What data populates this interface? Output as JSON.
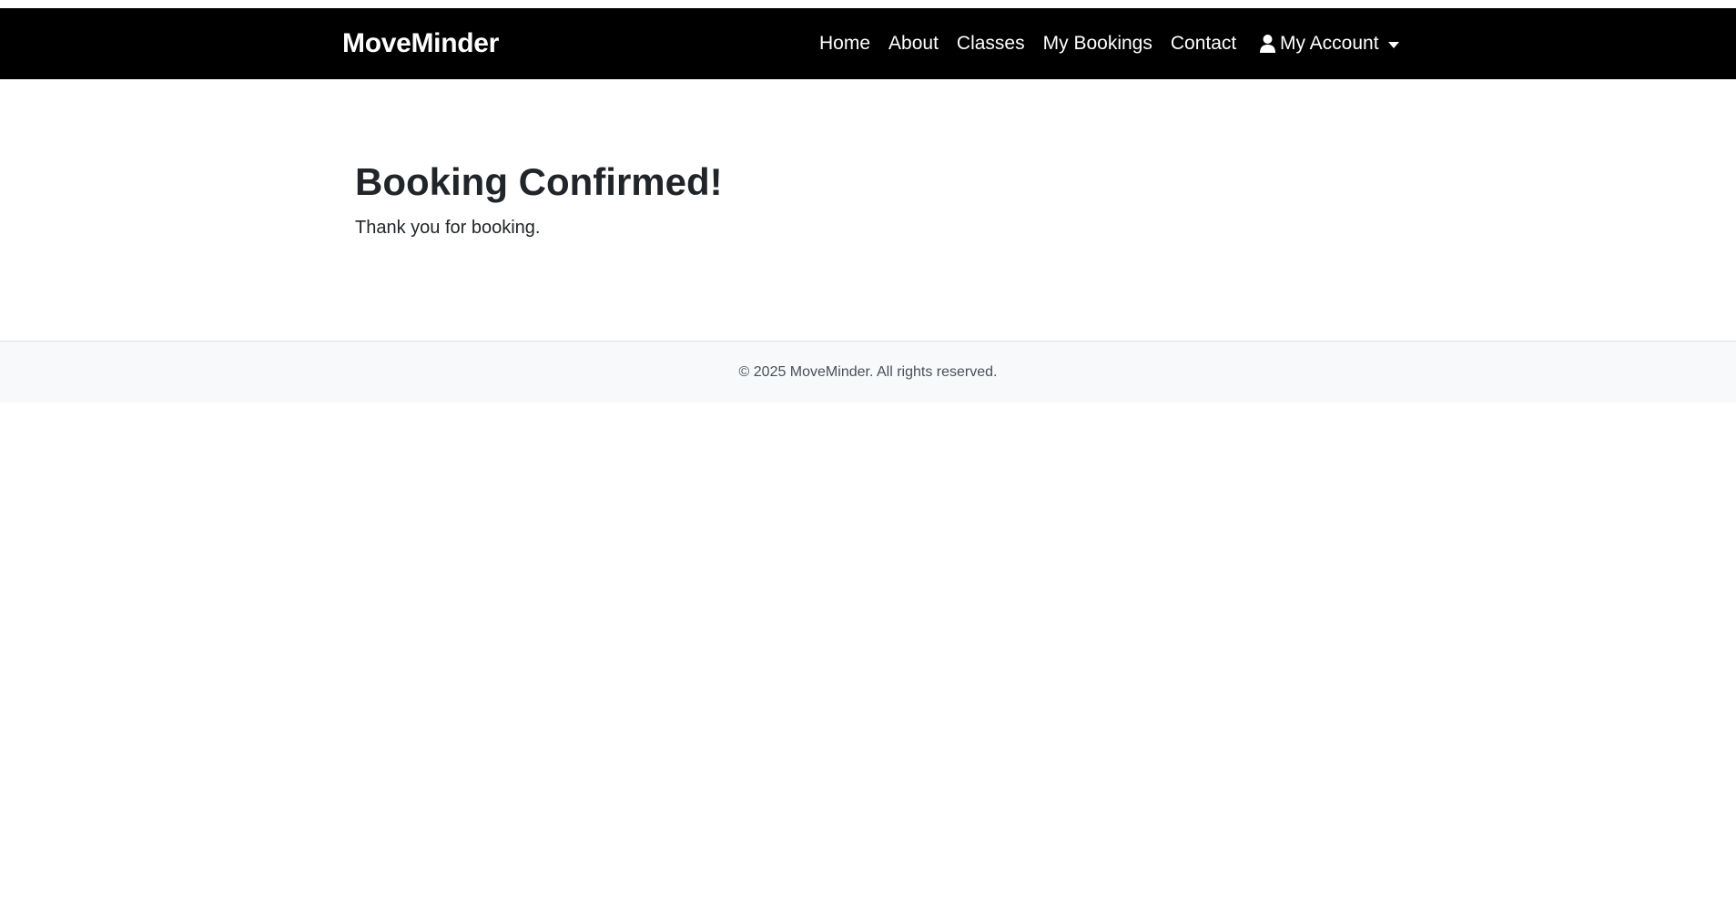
{
  "navbar": {
    "brand": "MoveMinder",
    "links": [
      {
        "label": "Home"
      },
      {
        "label": "About"
      },
      {
        "label": "Classes"
      },
      {
        "label": "My Bookings"
      },
      {
        "label": "Contact"
      }
    ],
    "account": {
      "label": "My Account",
      "icon": "user-icon"
    }
  },
  "main": {
    "title": "Booking Confirmed!",
    "message": "Thank you for booking."
  },
  "footer": {
    "text": "© 2025 MoveMinder. All rights reserved."
  },
  "colors": {
    "navbar_bg": "#000000",
    "text": "#212529",
    "footer_bg": "#f8f9fa"
  }
}
